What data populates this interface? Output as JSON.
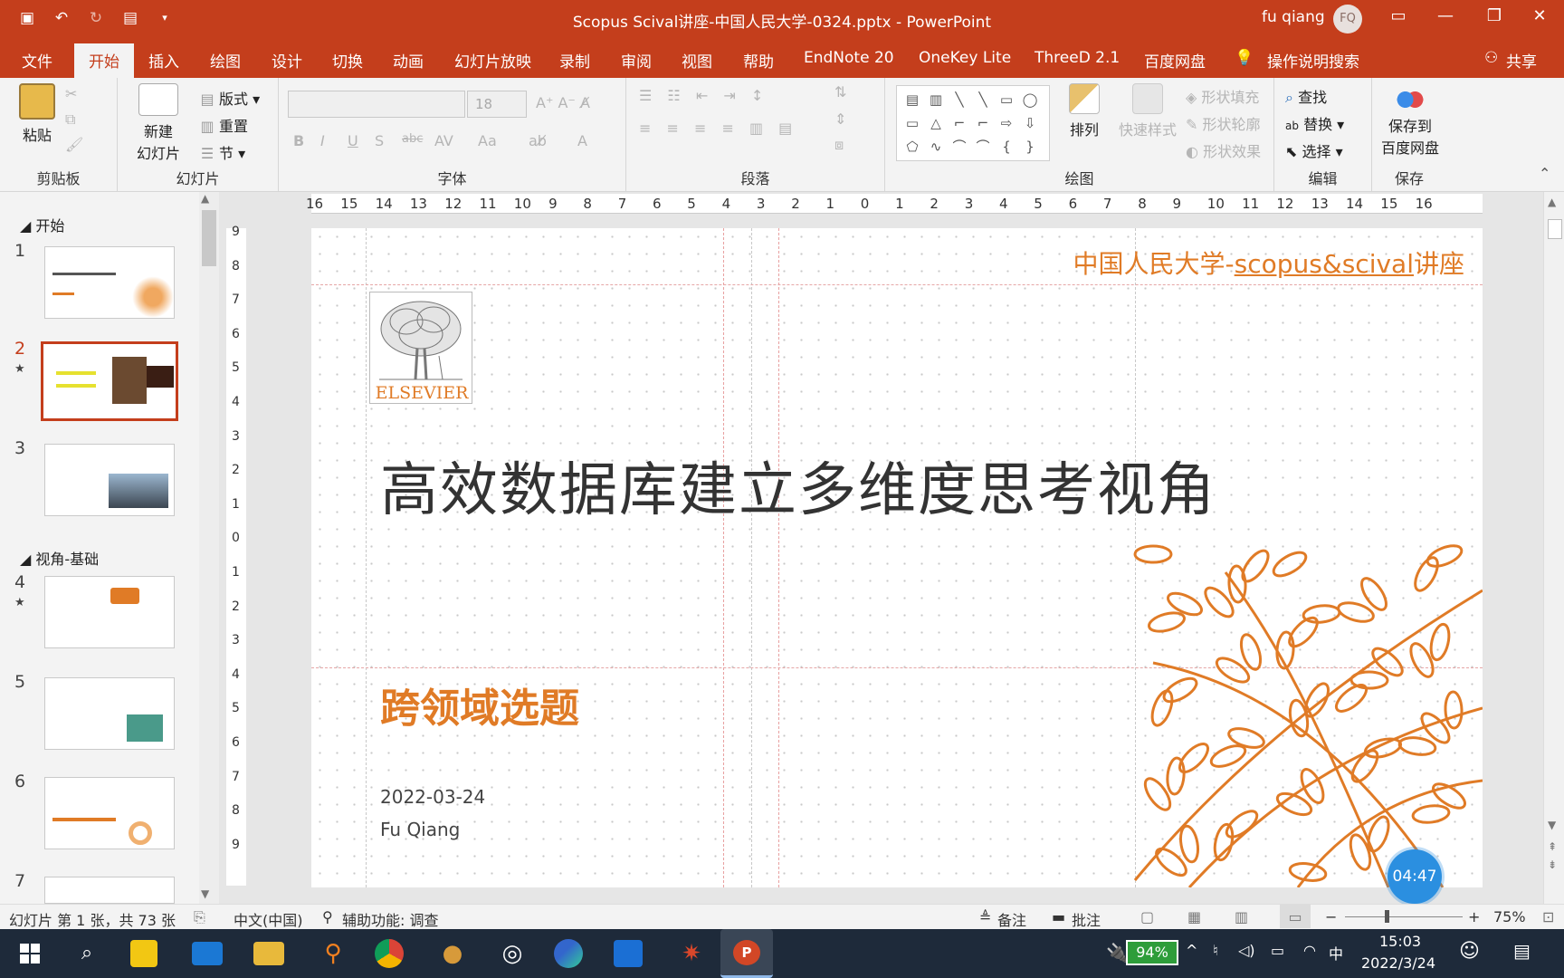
{
  "titlebar": {
    "title": "Scopus Scival讲座-中国人民大学-0324.pptx  -  PowerPoint",
    "user": "fu qiang",
    "avatar": "FQ",
    "quick_access": [
      "save-icon",
      "undo-icon",
      "redo-icon",
      "present-icon",
      "customize-icon"
    ],
    "window_buttons": [
      "□",
      "—",
      "❐",
      "✕"
    ]
  },
  "tabs": [
    "文件",
    "开始",
    "插入",
    "绘图",
    "设计",
    "切换",
    "动画",
    "幻灯片放映",
    "录制",
    "审阅",
    "视图",
    "帮助",
    "EndNote 20",
    "OneKey Lite",
    "ThreeD 2.1",
    "百度网盘"
  ],
  "tell_me": "操作说明搜索",
  "share": "共享",
  "ribbon": {
    "clipboard": {
      "label": "剪贴板",
      "paste": "粘贴"
    },
    "slides": {
      "label": "幻灯片",
      "new_slide_1": "新建",
      "new_slide_2": "幻灯片",
      "layout": "版式",
      "reset": "重置",
      "section": "节"
    },
    "font": {
      "label": "字体",
      "font_name": "",
      "font_size": "18",
      "bold": "B",
      "italic": "I",
      "underline": "U",
      "shadow": "S",
      "strike": "abc",
      "spacing": "AV",
      "case": "Aa",
      "color": "A"
    },
    "paragraph": {
      "label": "段落"
    },
    "drawing": {
      "label": "绘图",
      "arrange": "排列",
      "quick_styles": "快速样式",
      "shape_fill": "形状填充",
      "shape_outline": "形状轮廓",
      "shape_effects": "形状效果"
    },
    "editing": {
      "label": "编辑",
      "find": "查找",
      "replace": "替换",
      "select": "选择"
    },
    "save": {
      "label": "保存",
      "save_to_1": "保存到",
      "save_to_2": "百度网盘"
    }
  },
  "outline": {
    "sections": [
      "开始",
      "视角-基础"
    ],
    "slide_numbers": [
      "1",
      "2",
      "3",
      "4",
      "5",
      "6",
      "7"
    ]
  },
  "ruler": {
    "h_ticks": [
      "16",
      "15",
      "14",
      "13",
      "12",
      "11",
      "10",
      "9",
      "8",
      "7",
      "6",
      "5",
      "4",
      "3",
      "2",
      "1",
      "0",
      "1",
      "2",
      "3",
      "4",
      "5",
      "6",
      "7",
      "8",
      "9",
      "10",
      "11",
      "12",
      "13",
      "14",
      "15",
      "16"
    ],
    "v_ticks": [
      "9",
      "8",
      "7",
      "6",
      "5",
      "4",
      "3",
      "2",
      "1",
      "0",
      "1",
      "2",
      "3",
      "4",
      "5",
      "6",
      "7",
      "8",
      "9"
    ]
  },
  "slide": {
    "header_prefix": "中国人民大学-",
    "header_link": "scopus&scival",
    "header_suffix": "讲座",
    "logo_text": "ELSEVIER",
    "title": "高效数据库建立多维度思考视角",
    "subtitle": "跨领域选题",
    "date": "2022-03-24",
    "author": "Fu Qiang"
  },
  "timer": "04:47",
  "status": {
    "slide_info": "幻灯片 第 1 张，共 73 张",
    "language": "中文(中国)",
    "accessibility": "辅助功能: 调查",
    "notes": "备注",
    "comments": "批注",
    "zoom": "75%"
  },
  "taskbar": {
    "battery": "94%",
    "ime": "中",
    "time": "15:03",
    "date": "2022/3/24"
  },
  "colors": {
    "accent": "#c43e1c",
    "slide_orange": "#e07b26"
  }
}
